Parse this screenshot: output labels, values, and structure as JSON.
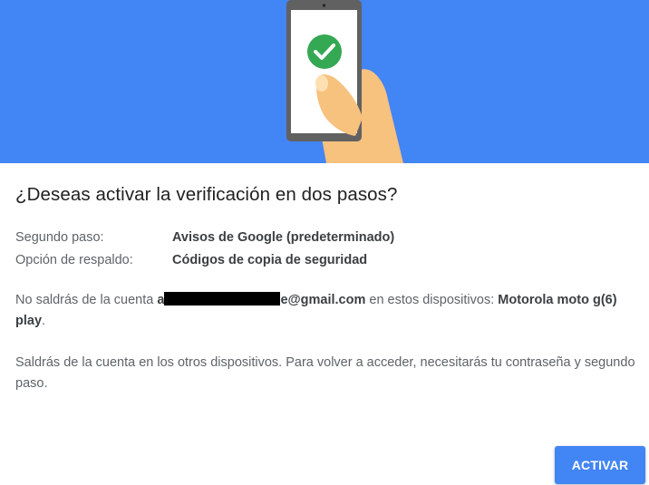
{
  "dialog": {
    "title": "¿Deseas activar la verificación en dos pasos?",
    "second_step_label": "Segundo paso:",
    "second_step_value": "Avisos de Google (predeterminado)",
    "backup_label": "Opción de respaldo:",
    "backup_value": "Códigos de copia de seguridad",
    "p1_before": "No saldrás de la cuenta ",
    "p1_email_visible_start": "a",
    "p1_email_visible_end": "e@gmail.com",
    "p1_middle": " en estos dispositivos: ",
    "p1_device": "Motorola moto g(6) play",
    "p1_end": ".",
    "p2": "Saldrás de la cuenta en los otros dispositivos. Para volver a acceder, necesitarás tu contraseña y segundo paso.",
    "activate_label": "ACTIVAR"
  },
  "colors": {
    "hero_background": "#4285f4",
    "button_background": "#4285f4",
    "check_circle": "#34a853"
  },
  "icons": {
    "hero_illustration": "hand-holding-phone-with-checkmark"
  }
}
